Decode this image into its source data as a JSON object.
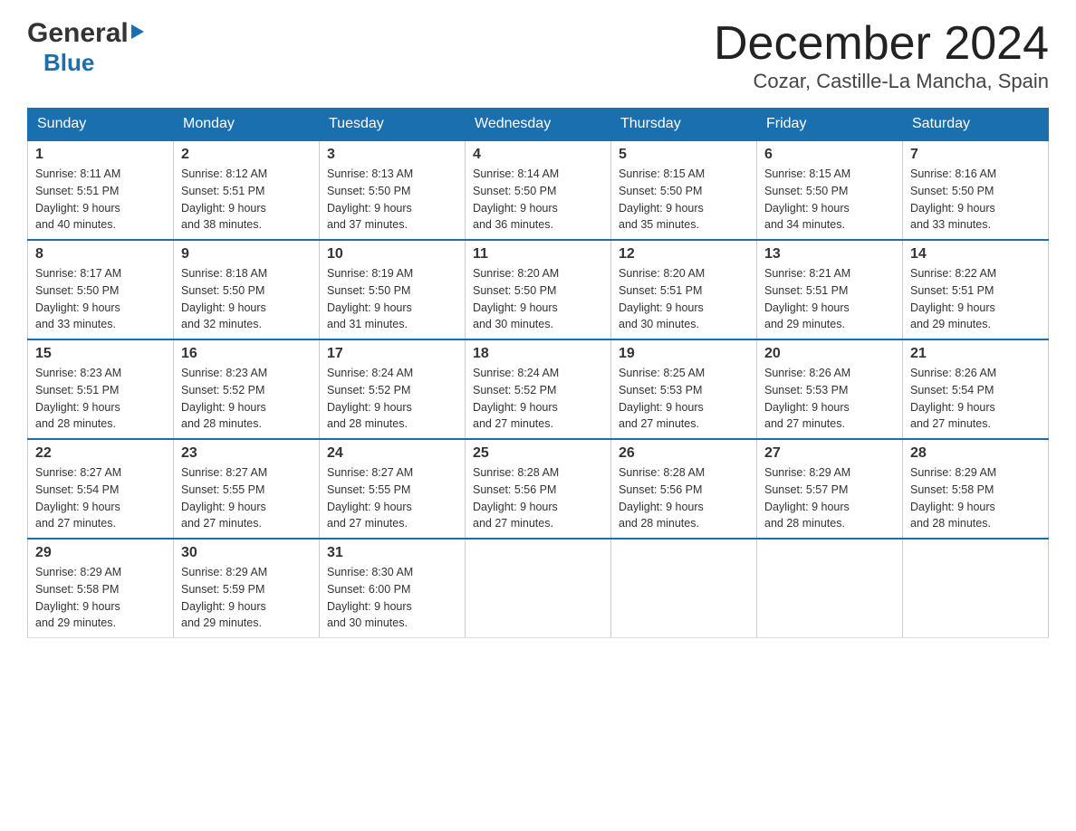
{
  "logo": {
    "general": "General",
    "blue": "Blue",
    "arrow_color": "#1a6faf"
  },
  "title": "December 2024",
  "subtitle": "Cozar, Castille-La Mancha, Spain",
  "days_of_week": [
    "Sunday",
    "Monday",
    "Tuesday",
    "Wednesday",
    "Thursday",
    "Friday",
    "Saturday"
  ],
  "weeks": [
    [
      {
        "day": "1",
        "sunrise": "8:11 AM",
        "sunset": "5:51 PM",
        "daylight": "9 hours and 40 minutes."
      },
      {
        "day": "2",
        "sunrise": "8:12 AM",
        "sunset": "5:51 PM",
        "daylight": "9 hours and 38 minutes."
      },
      {
        "day": "3",
        "sunrise": "8:13 AM",
        "sunset": "5:50 PM",
        "daylight": "9 hours and 37 minutes."
      },
      {
        "day": "4",
        "sunrise": "8:14 AM",
        "sunset": "5:50 PM",
        "daylight": "9 hours and 36 minutes."
      },
      {
        "day": "5",
        "sunrise": "8:15 AM",
        "sunset": "5:50 PM",
        "daylight": "9 hours and 35 minutes."
      },
      {
        "day": "6",
        "sunrise": "8:15 AM",
        "sunset": "5:50 PM",
        "daylight": "9 hours and 34 minutes."
      },
      {
        "day": "7",
        "sunrise": "8:16 AM",
        "sunset": "5:50 PM",
        "daylight": "9 hours and 33 minutes."
      }
    ],
    [
      {
        "day": "8",
        "sunrise": "8:17 AM",
        "sunset": "5:50 PM",
        "daylight": "9 hours and 33 minutes."
      },
      {
        "day": "9",
        "sunrise": "8:18 AM",
        "sunset": "5:50 PM",
        "daylight": "9 hours and 32 minutes."
      },
      {
        "day": "10",
        "sunrise": "8:19 AM",
        "sunset": "5:50 PM",
        "daylight": "9 hours and 31 minutes."
      },
      {
        "day": "11",
        "sunrise": "8:20 AM",
        "sunset": "5:50 PM",
        "daylight": "9 hours and 30 minutes."
      },
      {
        "day": "12",
        "sunrise": "8:20 AM",
        "sunset": "5:51 PM",
        "daylight": "9 hours and 30 minutes."
      },
      {
        "day": "13",
        "sunrise": "8:21 AM",
        "sunset": "5:51 PM",
        "daylight": "9 hours and 29 minutes."
      },
      {
        "day": "14",
        "sunrise": "8:22 AM",
        "sunset": "5:51 PM",
        "daylight": "9 hours and 29 minutes."
      }
    ],
    [
      {
        "day": "15",
        "sunrise": "8:23 AM",
        "sunset": "5:51 PM",
        "daylight": "9 hours and 28 minutes."
      },
      {
        "day": "16",
        "sunrise": "8:23 AM",
        "sunset": "5:52 PM",
        "daylight": "9 hours and 28 minutes."
      },
      {
        "day": "17",
        "sunrise": "8:24 AM",
        "sunset": "5:52 PM",
        "daylight": "9 hours and 28 minutes."
      },
      {
        "day": "18",
        "sunrise": "8:24 AM",
        "sunset": "5:52 PM",
        "daylight": "9 hours and 27 minutes."
      },
      {
        "day": "19",
        "sunrise": "8:25 AM",
        "sunset": "5:53 PM",
        "daylight": "9 hours and 27 minutes."
      },
      {
        "day": "20",
        "sunrise": "8:26 AM",
        "sunset": "5:53 PM",
        "daylight": "9 hours and 27 minutes."
      },
      {
        "day": "21",
        "sunrise": "8:26 AM",
        "sunset": "5:54 PM",
        "daylight": "9 hours and 27 minutes."
      }
    ],
    [
      {
        "day": "22",
        "sunrise": "8:27 AM",
        "sunset": "5:54 PM",
        "daylight": "9 hours and 27 minutes."
      },
      {
        "day": "23",
        "sunrise": "8:27 AM",
        "sunset": "5:55 PM",
        "daylight": "9 hours and 27 minutes."
      },
      {
        "day": "24",
        "sunrise": "8:27 AM",
        "sunset": "5:55 PM",
        "daylight": "9 hours and 27 minutes."
      },
      {
        "day": "25",
        "sunrise": "8:28 AM",
        "sunset": "5:56 PM",
        "daylight": "9 hours and 27 minutes."
      },
      {
        "day": "26",
        "sunrise": "8:28 AM",
        "sunset": "5:56 PM",
        "daylight": "9 hours and 28 minutes."
      },
      {
        "day": "27",
        "sunrise": "8:29 AM",
        "sunset": "5:57 PM",
        "daylight": "9 hours and 28 minutes."
      },
      {
        "day": "28",
        "sunrise": "8:29 AM",
        "sunset": "5:58 PM",
        "daylight": "9 hours and 28 minutes."
      }
    ],
    [
      {
        "day": "29",
        "sunrise": "8:29 AM",
        "sunset": "5:58 PM",
        "daylight": "9 hours and 29 minutes."
      },
      {
        "day": "30",
        "sunrise": "8:29 AM",
        "sunset": "5:59 PM",
        "daylight": "9 hours and 29 minutes."
      },
      {
        "day": "31",
        "sunrise": "8:30 AM",
        "sunset": "6:00 PM",
        "daylight": "9 hours and 30 minutes."
      },
      null,
      null,
      null,
      null
    ]
  ],
  "labels": {
    "sunrise": "Sunrise:",
    "sunset": "Sunset:",
    "daylight": "Daylight:"
  }
}
